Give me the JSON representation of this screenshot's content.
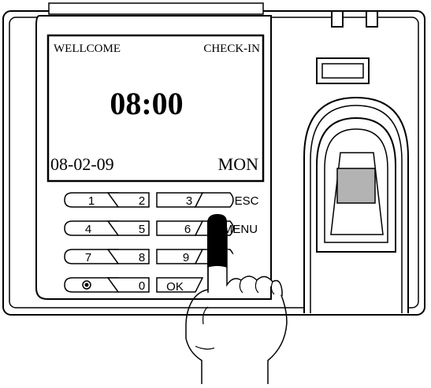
{
  "screen": {
    "greeting": "WELLCOME",
    "mode": "CHECK-IN",
    "time": "08:00",
    "date": "08-02-09",
    "weekday": "MON"
  },
  "keypad": {
    "keys": [
      {
        "label": "1",
        "name": "key-1"
      },
      {
        "label": "2",
        "name": "key-2"
      },
      {
        "label": "3",
        "name": "key-3"
      },
      {
        "label": "ESC",
        "name": "key-esc"
      },
      {
        "label": "4",
        "name": "key-4"
      },
      {
        "label": "5",
        "name": "key-5"
      },
      {
        "label": "6",
        "name": "key-6"
      },
      {
        "label": "MENU",
        "name": "key-menu"
      },
      {
        "label": "7",
        "name": "key-7"
      },
      {
        "label": "8",
        "name": "key-8"
      },
      {
        "label": "9",
        "name": "key-9"
      },
      {
        "label": "0",
        "name": "key-0"
      },
      {
        "label": "OK",
        "name": "key-ok"
      }
    ]
  },
  "icons": {
    "power": "power-key-icon",
    "fingerprint": "fingerprint-sensor-icon",
    "hand": "pointing-hand-icon"
  },
  "colors": {
    "stroke": "#000000",
    "sensor": "#b3b3b3",
    "fingertip": "#000000",
    "background": "#ffffff"
  }
}
